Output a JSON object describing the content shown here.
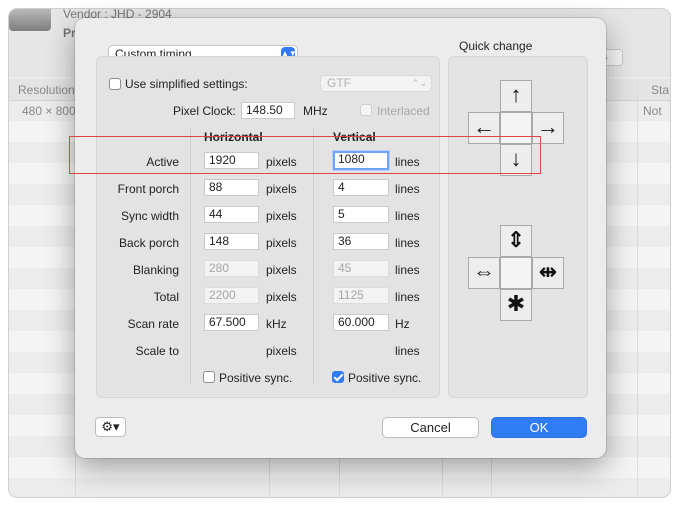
{
  "background": {
    "vendor": "Vendor : JHD - 2904",
    "pr": "Pr",
    "button_fragment": "s",
    "col_resolution": "Resolution",
    "col_status": "Sta",
    "row_resolution": "480 × 800",
    "row_status": "Not s"
  },
  "dialog": {
    "timing_preset": "Custom timing",
    "use_simplified_label": "Use simplified settings:",
    "simplified_method": "GTF",
    "pixel_clock_label": "Pixel Clock:",
    "pixel_clock_value": "148.50",
    "pixel_clock_unit": "MHz",
    "interlaced_label": "Interlaced",
    "col_horizontal": "Horizontal",
    "col_vertical": "Vertical",
    "rows": [
      {
        "label": "Active",
        "h": "1920",
        "h_unit": "pixels",
        "v": "1080",
        "v_unit": "lines"
      },
      {
        "label": "Front porch",
        "h": "88",
        "h_unit": "pixels",
        "v": "4",
        "v_unit": "lines"
      },
      {
        "label": "Sync width",
        "h": "44",
        "h_unit": "pixels",
        "v": "5",
        "v_unit": "lines"
      },
      {
        "label": "Back porch",
        "h": "148",
        "h_unit": "pixels",
        "v": "36",
        "v_unit": "lines"
      },
      {
        "label": "Blanking",
        "h": "280",
        "h_unit": "pixels",
        "v": "45",
        "v_unit": "lines"
      },
      {
        "label": "Total",
        "h": "2200",
        "h_unit": "pixels",
        "v": "1125",
        "v_unit": "lines"
      },
      {
        "label": "Scan rate",
        "h": "67.500",
        "h_unit": "kHz",
        "v": "60.000",
        "v_unit": "Hz"
      },
      {
        "label": "Scale to",
        "h": "",
        "h_unit": "pixels",
        "v": "",
        "v_unit": "lines"
      }
    ],
    "h_positive_sync": "Positive sync.",
    "v_positive_sync": "Positive sync.",
    "h_positive_sync_checked": false,
    "v_positive_sync_checked": true,
    "quick_change_title": "Quick change",
    "cancel_label": "Cancel",
    "ok_label": "OK",
    "icons": {
      "move_up": "↑",
      "move_down": "↓",
      "move_left": "←",
      "move_right": "→",
      "stretch_v": "⇕",
      "shrink_v": "✱",
      "stretch_h": "⇔",
      "shrink_h": "⇹",
      "gear": "⚙▾"
    },
    "accent_color": "#2f7cf6"
  }
}
